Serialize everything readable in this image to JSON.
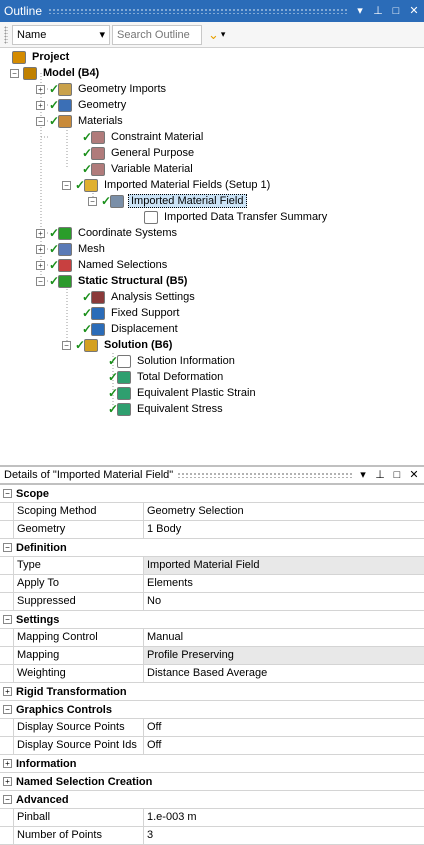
{
  "outline": {
    "title": "Outline",
    "title_icons": [
      "▾",
      "⊥",
      "□",
      "✕"
    ],
    "name_select": "Name",
    "search_placeholder": "Search Outline",
    "tree": [
      {
        "label": "Project",
        "bold": true,
        "icon": "project-icon",
        "color": "#d48b00"
      },
      {
        "label": "Model (B4)",
        "bold": true,
        "icon": "model-icon",
        "color": "#c08000"
      },
      {
        "label": "Geometry Imports",
        "bold": false,
        "icon": "geometry-imports-icon",
        "color": "#c9a14a"
      },
      {
        "label": "Geometry",
        "bold": false,
        "icon": "geometry-icon",
        "color": "#3b6fb6"
      },
      {
        "label": "Materials",
        "bold": false,
        "icon": "materials-icon",
        "color": "#c98b3a"
      },
      {
        "label": "Constraint Material",
        "bold": false,
        "icon": "material-tag-icon",
        "color": "#b07b7b"
      },
      {
        "label": "General Purpose",
        "bold": false,
        "icon": "material-tag-icon",
        "color": "#b07b7b"
      },
      {
        "label": "Variable Material",
        "bold": false,
        "icon": "material-tag-icon",
        "color": "#b07b7b"
      },
      {
        "label": "Imported Material Fields (Setup 1)",
        "bold": false,
        "icon": "imported-folder-icon",
        "color": "#e0b030"
      },
      {
        "label": "Imported Material Field",
        "bold": false,
        "icon": "imported-field-icon",
        "color": "#7a8fa8"
      },
      {
        "label": "Imported Data Transfer Summary",
        "bold": false,
        "icon": "comment-icon",
        "color": "#ffffff"
      },
      {
        "label": "Coordinate Systems",
        "bold": false,
        "icon": "coordinate-icon",
        "color": "#2a9d2a"
      },
      {
        "label": "Mesh",
        "bold": false,
        "icon": "mesh-icon",
        "color": "#5a7ab6"
      },
      {
        "label": "Named Selections",
        "bold": false,
        "icon": "named-selection-icon",
        "color": "#c84040"
      },
      {
        "label": "Static Structural (B5)",
        "bold": true,
        "icon": "static-structural-icon",
        "color": "#2c9a2c"
      },
      {
        "label": "Analysis Settings",
        "bold": false,
        "icon": "analysis-settings-icon",
        "color": "#8a3a3a"
      },
      {
        "label": "Fixed Support",
        "bold": false,
        "icon": "fixed-support-icon",
        "color": "#2b6cb8"
      },
      {
        "label": "Displacement",
        "bold": false,
        "icon": "displacement-icon",
        "color": "#2b6cb8"
      },
      {
        "label": "Solution (B6)",
        "bold": true,
        "icon": "solution-icon",
        "color": "#d4a020"
      },
      {
        "label": "Solution Information",
        "bold": false,
        "icon": "solution-info-icon",
        "color": "#ffffff"
      },
      {
        "label": "Total Deformation",
        "bold": false,
        "icon": "result-icon",
        "color": "#2f9f6f"
      },
      {
        "label": "Equivalent Plastic Strain",
        "bold": false,
        "icon": "result-icon",
        "color": "#2f9f6f"
      },
      {
        "label": "Equivalent Stress",
        "bold": false,
        "icon": "result-icon",
        "color": "#2f9f6f"
      }
    ]
  },
  "details": {
    "title": "Details of \"Imported Material Field\"",
    "sections": [
      {
        "name": "Scope",
        "expanded": true,
        "rows": [
          {
            "prop": "Scoping Method",
            "value": "Geometry Selection",
            "gray": false
          },
          {
            "prop": "Geometry",
            "value": "1 Body",
            "gray": false
          }
        ]
      },
      {
        "name": "Definition",
        "expanded": true,
        "rows": [
          {
            "prop": "Type",
            "value": "Imported Material Field",
            "gray": true
          },
          {
            "prop": "Apply To",
            "value": "Elements",
            "gray": false
          },
          {
            "prop": "Suppressed",
            "value": "No",
            "gray": false
          }
        ]
      },
      {
        "name": "Settings",
        "expanded": true,
        "rows": [
          {
            "prop": "Mapping Control",
            "value": "Manual",
            "gray": false
          },
          {
            "prop": "Mapping",
            "value": "Profile Preserving",
            "gray": true
          },
          {
            "prop": "Weighting",
            "value": "Distance Based Average",
            "gray": false
          }
        ]
      },
      {
        "name": "Rigid Transformation",
        "expanded": false,
        "rows": []
      },
      {
        "name": "Graphics Controls",
        "expanded": true,
        "rows": [
          {
            "prop": "Display Source Points",
            "value": "Off",
            "gray": false
          },
          {
            "prop": "Display Source Point Ids",
            "value": "Off",
            "gray": false
          }
        ]
      },
      {
        "name": "Information",
        "expanded": false,
        "rows": []
      },
      {
        "name": "Named Selection Creation",
        "expanded": false,
        "rows": []
      },
      {
        "name": "Advanced",
        "expanded": true,
        "rows": [
          {
            "prop": "Pinball",
            "value": "1.e-003 m",
            "gray": false
          },
          {
            "prop": "Number of Points",
            "value": "3",
            "gray": false
          }
        ]
      }
    ]
  }
}
